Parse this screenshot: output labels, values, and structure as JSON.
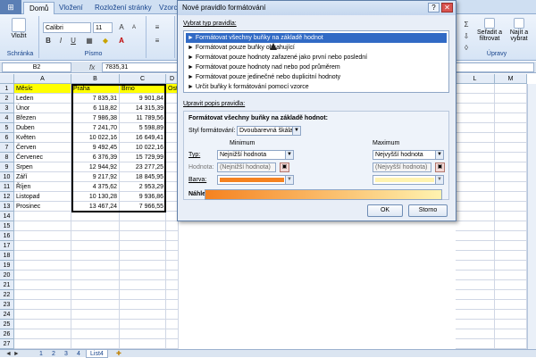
{
  "ribbon": {
    "office_button": "⊞",
    "tabs": [
      "Domů",
      "Vložení",
      "Rozložení stránky",
      "Vzorce"
    ],
    "groups": {
      "clipboard": {
        "label": "Schránka",
        "paste": "Vložit"
      },
      "font": {
        "label": "Písmo",
        "font_name": "Calibri",
        "font_size": "11",
        "bold": "B",
        "italic": "I",
        "underline": "U"
      },
      "editing": {
        "label": "Úpravy",
        "sort": "Seřadit a filtrovat",
        "find": "Najít a vybrat"
      }
    }
  },
  "formula_bar": {
    "cell_ref": "B2",
    "fx": "fx",
    "value": "7835,31"
  },
  "sheet": {
    "columns": [
      "A",
      "B",
      "C",
      "D",
      "L",
      "M"
    ],
    "rows": [
      {
        "n": "1",
        "a": "Měsíc",
        "b": "Praha",
        "c": "Brno",
        "d": "Ost"
      },
      {
        "n": "2",
        "a": "Leden",
        "b": "7 835,31",
        "c": "9 901,84"
      },
      {
        "n": "3",
        "a": "Únor",
        "b": "6 118,82",
        "c": "14 315,39"
      },
      {
        "n": "4",
        "a": "Březen",
        "b": "7 986,38",
        "c": "11 789,56"
      },
      {
        "n": "5",
        "a": "Duben",
        "b": "7 241,70",
        "c": "5 598,89"
      },
      {
        "n": "6",
        "a": "Květen",
        "b": "10 022,16",
        "c": "16 649,41"
      },
      {
        "n": "7",
        "a": "Červen",
        "b": "9 492,45",
        "c": "10 022,16"
      },
      {
        "n": "8",
        "a": "Červenec",
        "b": "6 376,39",
        "c": "15 729,99"
      },
      {
        "n": "9",
        "a": "Srpen",
        "b": "12 944,92",
        "c": "23 277,25"
      },
      {
        "n": "10",
        "a": "Září",
        "b": "9 217,92",
        "c": "18 845,95"
      },
      {
        "n": "11",
        "a": "Říjen",
        "b": "4 375,62",
        "c": "2 953,29"
      },
      {
        "n": "12",
        "a": "Listopad",
        "b": "10 130,28",
        "c": "9 936,86"
      },
      {
        "n": "13",
        "a": "Prosinec",
        "b": "13 467,24",
        "c": "7 966,55"
      },
      {
        "n": "14"
      },
      {
        "n": "15"
      },
      {
        "n": "16"
      },
      {
        "n": "17"
      },
      {
        "n": "18"
      },
      {
        "n": "19"
      },
      {
        "n": "20"
      },
      {
        "n": "21"
      },
      {
        "n": "22"
      },
      {
        "n": "23"
      },
      {
        "n": "24"
      },
      {
        "n": "25"
      },
      {
        "n": "26"
      },
      {
        "n": "27"
      }
    ],
    "tabs": [
      "1",
      "2",
      "3",
      "4",
      "List4"
    ]
  },
  "dialog": {
    "title": "Nové pravidlo formátování",
    "help": "?",
    "close": "✕",
    "select_rule_label": "Vybrat typ pravidla:",
    "rule_types": [
      "► Formátovat všechny buňky na základě hodnot",
      "► Formátovat pouze buňky obsahující",
      "► Formátovat pouze hodnoty zařazené jako první nebo poslední",
      "► Formátovat pouze hodnoty nad nebo pod průměrem",
      "► Formátovat pouze jedinečné nebo duplicitní hodnoty",
      "► Určit buňky k formátování pomocí vzorce"
    ],
    "edit_label": "Upravit popis pravidla:",
    "section_title": "Formátovat všechny buňky na základě hodnot:",
    "style_label": "Styl formátování:",
    "style_value": "Dvoubarevná škála",
    "min_label": "Minimum",
    "max_label": "Maximum",
    "type_label": "Typ:",
    "value_label": "Hodnota:",
    "color_label": "Barva:",
    "min_type": "Nejnižší hodnota",
    "max_type": "Nejvyšší hodnota",
    "min_value": "(Nejnižší hodnota)",
    "max_value": "(Nejvyšší hodnota)",
    "min_color": "#f58220",
    "max_color": "#fff3b0",
    "preview_label": "Náhled:",
    "ok": "OK",
    "cancel": "Storno"
  }
}
